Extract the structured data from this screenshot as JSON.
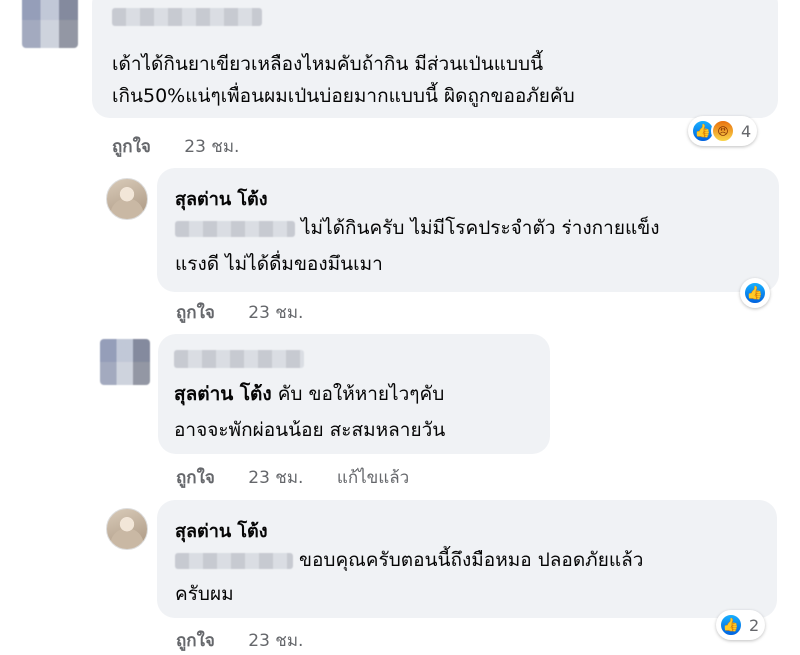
{
  "comments": [
    {
      "text_lines": [
        "เด้าได้กินยาเขียวเหลืองไหมคับถ้ากิน มีส่วนเป่นแบบนี้",
        "เกิน50%แน่ๆเพื่อนผมเป่นบ่อยมากแบบนี้ ผิดถูกขออภัยคับ"
      ],
      "like_label": "ถูกใจ",
      "time": "23 ชม.",
      "reaction_count": "4"
    },
    {
      "name": "สุลต่าน โต้ง",
      "text_line1_after_mention": "ไม่ได้กินครับ ไม่มีโรคประจำตัว ร่างกายแข็ง",
      "text_line2": "แรงดี ไม่ได้ดื่มของมึนเมา",
      "like_label": "ถูกใจ",
      "time": "23 ชม."
    },
    {
      "mention": "สุลต่าน โต้ง",
      "text_line1_after_mention": "คับ ขอให้หายไวๆคับ",
      "text_line2": "อาจจะพักผ่อนน้อย สะสมหลายวัน",
      "like_label": "ถูกใจ",
      "time": "23 ชม.",
      "edited": "แก้ไขแล้ว"
    },
    {
      "name": "สุลต่าน โต้ง",
      "text_line1_after_mention": "ขอบคุณครับตอนนี้ถึงมือหมอ ปลอดภัยแล้ว",
      "text_line2": "ครับผม",
      "like_label": "ถูกใจ",
      "time": "23 ชม.",
      "reaction_count": "2"
    }
  ]
}
